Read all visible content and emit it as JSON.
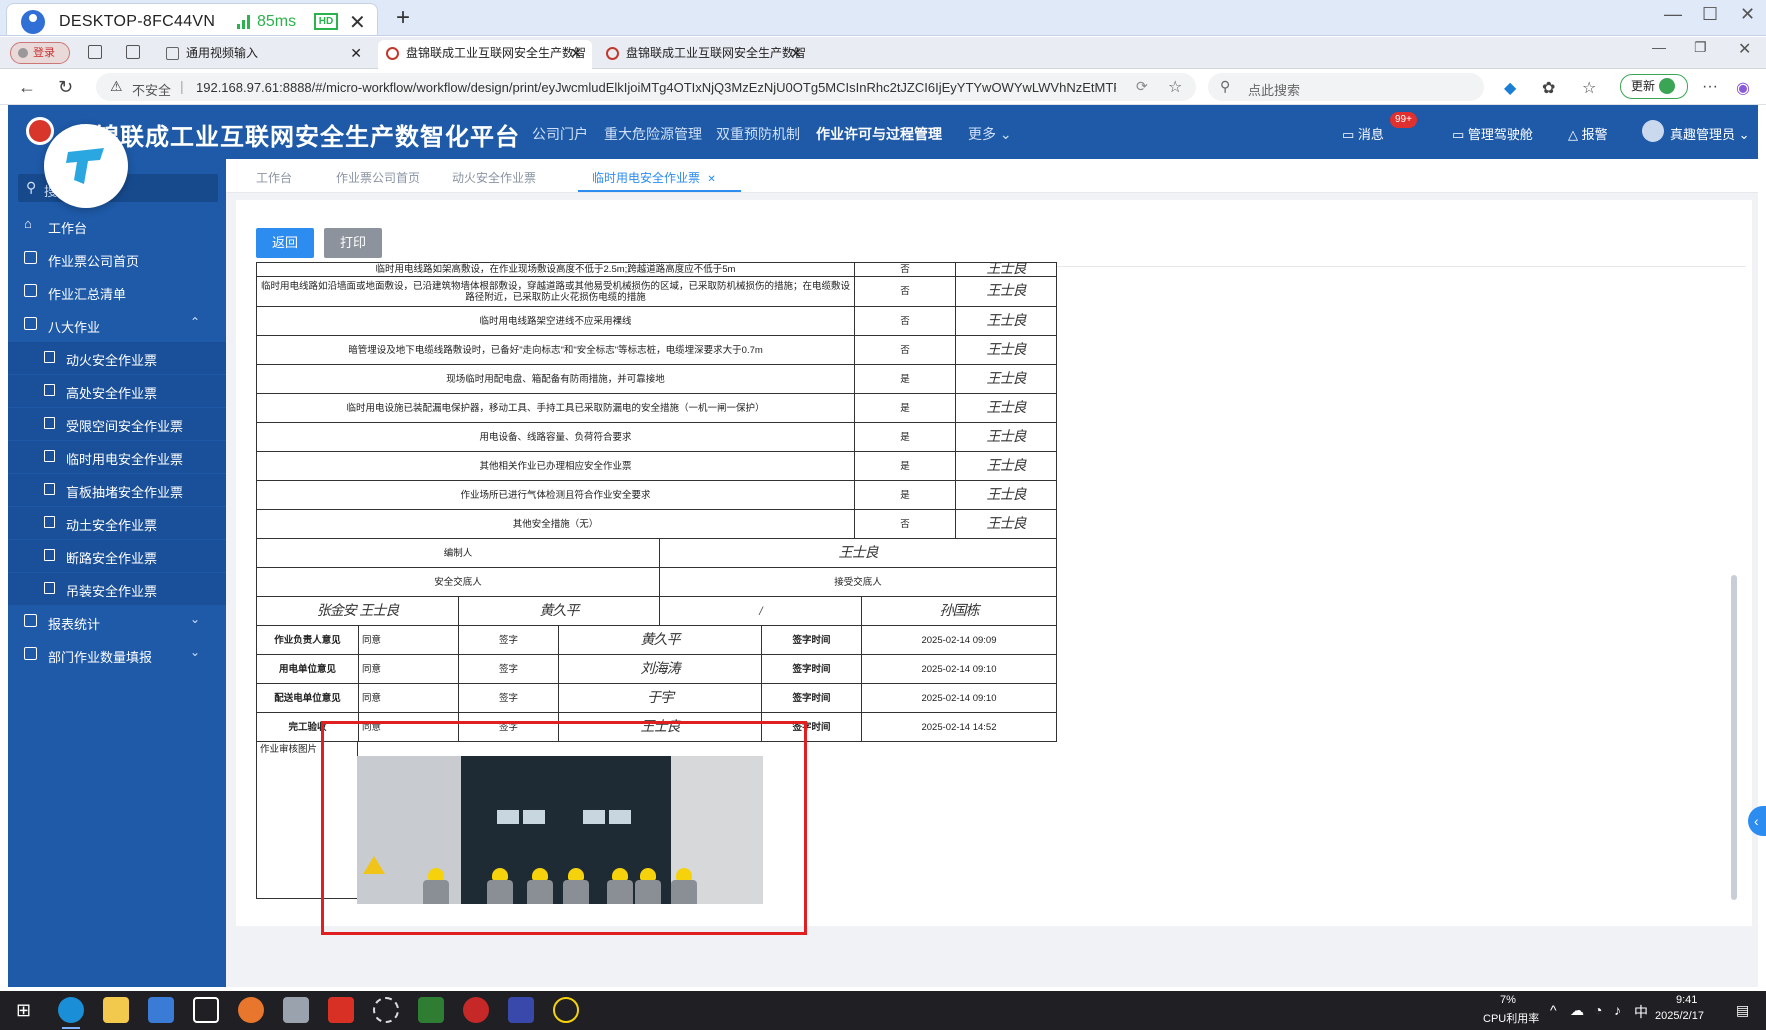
{
  "remote": {
    "host": "DESKTOP-8FC44VN",
    "ping": "85ms",
    "quality": "HD"
  },
  "browser": {
    "login_label": "登录",
    "tabs": [
      {
        "label": "通用视频输入"
      },
      {
        "label": "盘锦联成工业互联网安全生产数智"
      },
      {
        "label": "盘锦联成工业互联网安全生产数智"
      }
    ],
    "insecure_label": "不安全",
    "url": "192.168.97.61:8888/#/micro-workflow/workflow/design/print/eyJwcmludElkIjoiMTg4OTIxNjQ3MzEzNjU0OTg5MCIsInRhc2tJZCI6IjEyYTYwOWYwLWVhNzEtMTFiZi0...",
    "search_placeholder": "点此搜索",
    "update_label": "更新"
  },
  "app": {
    "title": "盘锦联成工业互联网安全生产数智化平台",
    "nav": [
      "公司门户",
      "重大危险源管理",
      "双重预防机制",
      "作业许可与过程管理",
      "更多"
    ],
    "message_label": "消息",
    "message_badge": "99+",
    "cockpit_label": "管理驾驶舱",
    "alarm_label": "报警",
    "user_label": "真趣管理员"
  },
  "sidebar": {
    "search_placeholder": "搜索",
    "items": [
      {
        "label": "工作台"
      },
      {
        "label": "作业票公司首页"
      },
      {
        "label": "作业汇总清单"
      },
      {
        "label": "八大作业"
      }
    ],
    "sub_items": [
      {
        "label": "动火安全作业票"
      },
      {
        "label": "高处安全作业票"
      },
      {
        "label": "受限空间安全作业票"
      },
      {
        "label": "临时用电安全作业票"
      },
      {
        "label": "盲板抽堵安全作业票"
      },
      {
        "label": "动土安全作业票"
      },
      {
        "label": "断路安全作业票"
      },
      {
        "label": "吊装安全作业票"
      }
    ],
    "bottom_items": [
      {
        "label": "报表统计"
      },
      {
        "label": "部门作业数量填报"
      }
    ]
  },
  "content_tabs": [
    "工作台",
    "作业票公司首页",
    "动火安全作业票",
    "临时用电安全作业票"
  ],
  "actions": {
    "back": "返回",
    "print": "打印"
  },
  "document": {
    "measures": [
      {
        "text": "临时用电线路如架高敷设，在作业现场敷设高度不低于2.5m;跨越道路高度应不低于5m",
        "answer": "否",
        "signer": "王士良"
      },
      {
        "text": "临时用电线路如沿墙面或地面敷设，已沿建筑物墙体根部敷设，穿越道路或其他易受机械损伤的区域，已采取防机械损伤的措施；在电缆敷设路径附近，已采取防止火花损伤电缆的措施",
        "answer": "否",
        "signer": "王士良"
      },
      {
        "text": "临时用电线路架空进线不应采用裸线",
        "answer": "否",
        "signer": "王士良"
      },
      {
        "text": "暗管埋设及地下电缆线路敷设时，已备好\"走向标志\"和\"安全标志\"等标志桩，电缆埋深要求大于0.7m",
        "answer": "否",
        "signer": "王士良"
      },
      {
        "text": "现场临时用配电盘、箱配备有防雨措施，并可靠接地",
        "answer": "是",
        "signer": "王士良"
      },
      {
        "text": "临时用电设施已装配漏电保护器，移动工具、手持工具已采取防漏电的安全措施（一机一闸一保护）",
        "answer": "是",
        "signer": "王士良"
      },
      {
        "text": "用电设备、线路容量、负荷符合要求",
        "answer": "是",
        "signer": "王士良"
      },
      {
        "text": "其他相关作业已办理相应安全作业票",
        "answer": "是",
        "signer": "王士良"
      },
      {
        "text": "作业场所已进行气体检测且符合作业安全要求",
        "answer": "是",
        "signer": "王士良"
      },
      {
        "text": "其他安全措施（无）",
        "answer": "否",
        "signer": "王士良"
      }
    ],
    "compiler_label": "编制人",
    "compiler_sig": "王士良",
    "discloser_label": "安全交底人",
    "receiver_label": "接受交底人",
    "disclose_sigs": [
      "张金安 王士良",
      "黄久平",
      "/",
      "孙国栋"
    ],
    "opinions": [
      {
        "label": "作业负责人意见",
        "opinion": "同意",
        "sign_label": "签字",
        "sig": "黄久平",
        "time_label": "签字时间",
        "time": "2025-02-14 09:09"
      },
      {
        "label": "用电单位意见",
        "opinion": "同意",
        "sign_label": "签字",
        "sig": "刘海涛",
        "time_label": "签字时间",
        "time": "2025-02-14 09:10"
      },
      {
        "label": "配送电单位意见",
        "opinion": "同意",
        "sign_label": "签字",
        "sig": "于宇",
        "time_label": "签字时间",
        "time": "2025-02-14 09:10"
      },
      {
        "label": "完工验收",
        "opinion": "同意",
        "sign_label": "签字",
        "sig": "王士良",
        "time_label": "签字时间",
        "time": "2025-02-14 14:52"
      }
    ],
    "photo_label": "作业审核图片"
  },
  "taskbar": {
    "cpu_percent": "7%",
    "cpu_label": "CPU利用率",
    "time": "9:41",
    "date": "2025/2/17"
  },
  "colors": {
    "header_blue": "#1e5aa8",
    "primary": "#2d8cf0",
    "annotation_red": "#e02020"
  }
}
